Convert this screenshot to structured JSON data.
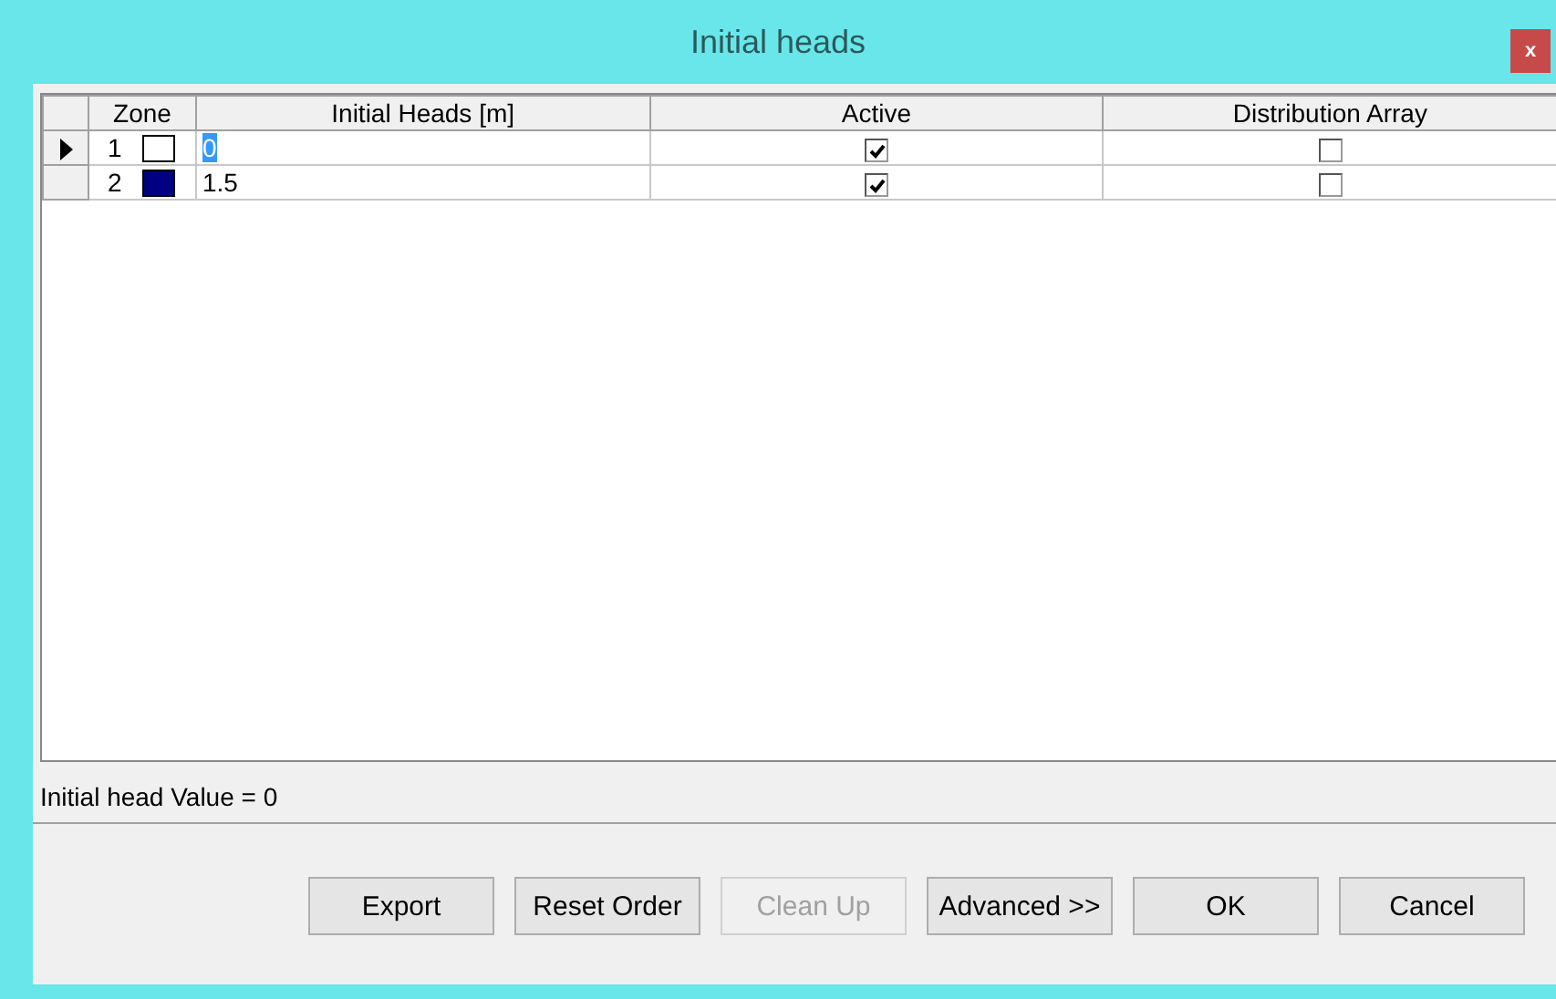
{
  "window": {
    "title": "Initial heads",
    "close": "x"
  },
  "table": {
    "columns": [
      "Zone",
      "Initial Heads [m]",
      "Active",
      "Distribution Array"
    ],
    "rows": [
      {
        "current": true,
        "zone": "1",
        "color": "#ffffff",
        "initial_head": "0",
        "editing": true,
        "active": true,
        "distribution_array": false
      },
      {
        "current": false,
        "zone": "2",
        "color": "#000080",
        "initial_head": "1.5",
        "editing": false,
        "active": true,
        "distribution_array": false
      }
    ]
  },
  "status_bar": "Initial head Value = 0",
  "buttons": [
    {
      "label": "Export",
      "disabled": false
    },
    {
      "label": "Reset Order",
      "disabled": false
    },
    {
      "label": "Clean Up",
      "disabled": true
    },
    {
      "label": "Advanced >>",
      "disabled": false
    },
    {
      "label": "OK",
      "disabled": false
    },
    {
      "label": "Cancel",
      "disabled": false
    }
  ]
}
